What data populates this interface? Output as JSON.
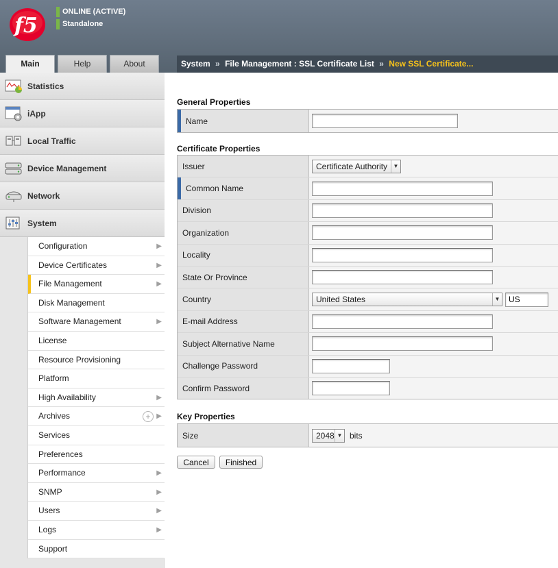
{
  "header": {
    "status": "ONLINE (ACTIVE)",
    "mode": "Standalone",
    "status_color": "#7ab648"
  },
  "tabs": [
    {
      "label": "Main",
      "active": true
    },
    {
      "label": "Help",
      "active": false
    },
    {
      "label": "About",
      "active": false
    }
  ],
  "breadcrumb": {
    "parts": [
      "System",
      "File Management : SSL Certificate List"
    ],
    "separator": "»",
    "current": "New SSL Certificate...",
    "current_color": "#f6c21b"
  },
  "sidebar": {
    "nav": [
      {
        "label": "Statistics",
        "icon": "statistics-icon"
      },
      {
        "label": "iApp",
        "icon": "iapp-icon"
      },
      {
        "label": "Local Traffic",
        "icon": "local-traffic-icon"
      },
      {
        "label": "Device Management",
        "icon": "device-management-icon"
      },
      {
        "label": "Network",
        "icon": "network-icon"
      },
      {
        "label": "System",
        "icon": "system-icon"
      }
    ],
    "submenu": [
      {
        "label": "Configuration",
        "arrow": true
      },
      {
        "label": "Device Certificates",
        "arrow": true
      },
      {
        "label": "File Management",
        "arrow": true,
        "active": true
      },
      {
        "label": "Disk Management",
        "arrow": false
      },
      {
        "label": "Software Management",
        "arrow": true
      },
      {
        "label": "License",
        "arrow": false
      },
      {
        "label": "Resource Provisioning",
        "arrow": false
      },
      {
        "label": "Platform",
        "arrow": false
      },
      {
        "label": "High Availability",
        "arrow": true
      },
      {
        "label": "Archives",
        "arrow": true,
        "plus": true
      },
      {
        "label": "Services",
        "arrow": false
      },
      {
        "label": "Preferences",
        "arrow": false
      },
      {
        "label": "Performance",
        "arrow": true
      },
      {
        "label": "SNMP",
        "arrow": true
      },
      {
        "label": "Users",
        "arrow": true
      },
      {
        "label": "Logs",
        "arrow": true
      },
      {
        "label": "Support",
        "arrow": false
      }
    ]
  },
  "general": {
    "title": "General Properties",
    "name_label": "Name",
    "name_value": ""
  },
  "certificate": {
    "title": "Certificate Properties",
    "issuer_label": "Issuer",
    "issuer_value": "Certificate Authority",
    "common_name_label": "Common Name",
    "division_label": "Division",
    "organization_label": "Organization",
    "locality_label": "Locality",
    "state_label": "State Or Province",
    "country_label": "Country",
    "country_value": "United States",
    "country_code": "US",
    "email_label": "E-mail Address",
    "san_label": "Subject Alternative Name",
    "challenge_label": "Challenge Password",
    "confirm_label": "Confirm Password"
  },
  "key": {
    "title": "Key Properties",
    "size_label": "Size",
    "size_value": "2048",
    "size_unit": "bits"
  },
  "buttons": {
    "cancel": "Cancel",
    "finished": "Finished"
  }
}
